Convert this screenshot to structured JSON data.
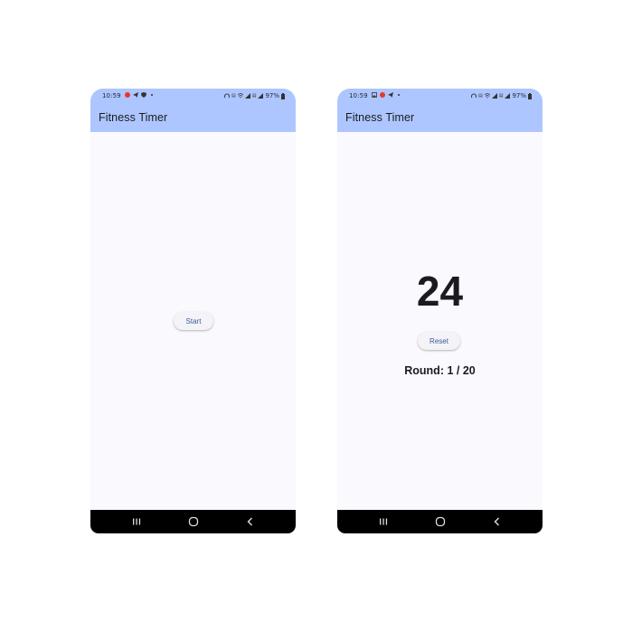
{
  "screens": [
    {
      "status": {
        "time": "10:59",
        "battery": "97%"
      },
      "app_title": "Fitness Timer",
      "start_label": "Start"
    },
    {
      "status": {
        "time": "10:59",
        "battery": "97%"
      },
      "app_title": "Fitness Timer",
      "counter": "24",
      "reset_label": "Reset",
      "round_text": "Round: 1 / 20"
    }
  ],
  "colors": {
    "app_bar": "#adc6ff",
    "background": "#f9f9fe",
    "button_text": "#3a5a9c",
    "nav_bar": "#000000"
  },
  "icons": {
    "nav": [
      "recents-icon",
      "home-icon",
      "back-icon"
    ]
  }
}
